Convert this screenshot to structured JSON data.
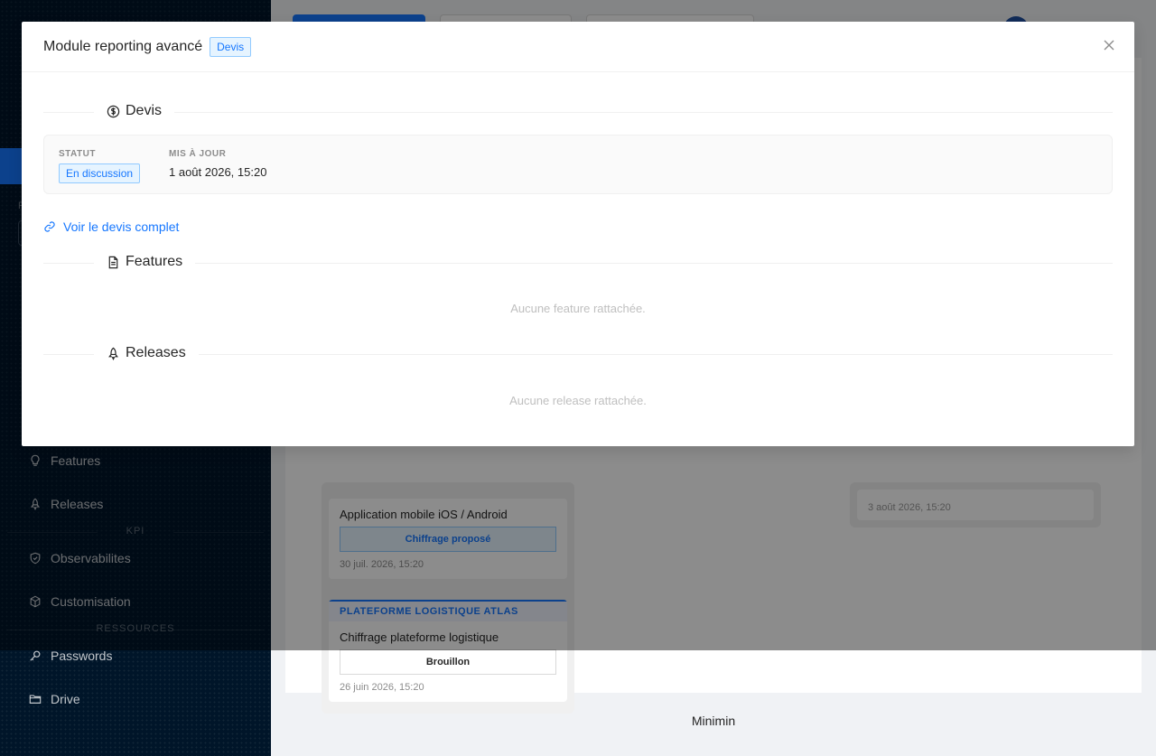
{
  "sidebar": {
    "section_letter": "F",
    "items": [
      {
        "label": "Features",
        "icon": "bulb-icon"
      },
      {
        "label": "Releases",
        "icon": "rocket-icon"
      },
      {
        "label": "Observabilites",
        "icon": "shield-icon"
      },
      {
        "label": "Customisation",
        "icon": "cube-icon"
      },
      {
        "label": "Passwords",
        "icon": "key-icon"
      },
      {
        "label": "Drive",
        "icon": "folder-icon"
      }
    ],
    "sections": {
      "kpi": "KPI",
      "resources": "RESSOURCES"
    }
  },
  "board": {
    "cards": [
      {
        "project": "",
        "title": "Application mobile iOS / Android",
        "status": "Chiffrage proposé",
        "date": "30 juil. 2026, 15:20"
      },
      {
        "project": "PLATEFORME LOGISTIQUE ATLAS",
        "title": "Chiffrage plateforme logistique",
        "status": "Brouillon",
        "date": "26 juin 2026, 15:20"
      }
    ],
    "right_card_date": "3 août 2026, 15:20"
  },
  "footer": {
    "text": "Minimin"
  },
  "modal": {
    "title": "Module reporting avancé",
    "tag": "Devis",
    "sections": {
      "devis": {
        "label": "Devis",
        "icon": "dollar-circle-icon"
      },
      "features": {
        "label": "Features",
        "icon": "file-text-icon",
        "empty": "Aucune feature rattachée."
      },
      "releases": {
        "label": "Releases",
        "icon": "rocket-icon",
        "empty": "Aucune release rattachée."
      }
    },
    "info": {
      "status_label": "STATUT",
      "status_value": "En discussion",
      "updated_label": "MIS À JOUR",
      "updated_value": "1 août 2026, 15:20"
    },
    "link_label": "Voir le devis complet"
  },
  "colors": {
    "primary": "#1677ff",
    "sidebar_bg": "#001529"
  }
}
